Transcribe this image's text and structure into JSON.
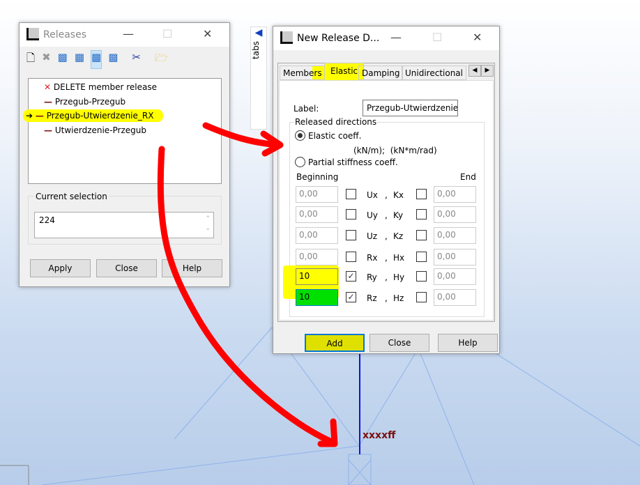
{
  "releases_window": {
    "title": "Releases",
    "list": [
      {
        "label": "DELETE member release",
        "icon": "delete-x-icon"
      },
      {
        "label": "Przegub-Przegub",
        "icon": "dash-icon"
      },
      {
        "label": "Przegub-Utwierdzenie_RX",
        "icon": "dash-icon",
        "current": true,
        "highlight": "#ffff00"
      },
      {
        "label": "Utwierdzenie-Przegub",
        "icon": "dash-icon"
      }
    ],
    "current_selection_label": "Current selection",
    "current_selection_value": "224",
    "apply": "Apply",
    "close": "Close",
    "help": "Help"
  },
  "side_tab": "tabs",
  "dialog": {
    "title": "New Release D...",
    "tabs": [
      "Members",
      "Elastic",
      "Damping",
      "Unidirectional"
    ],
    "active_tab": "Elastic",
    "label_caption": "Label:",
    "label_value": "Przegub-Utwierdzenie_",
    "group_title": "Released directions",
    "radio_elastic": "Elastic coeff.",
    "units": "(kN/m);  (kN*m/rad)",
    "radio_partial": "Partial stiffness coeff.",
    "beginning": "Beginning",
    "end": "End",
    "rows": [
      {
        "begin": "0,00",
        "begin_checked": false,
        "dir": "Ux",
        "sep": ",",
        "coef": "Kx",
        "end_checked": false,
        "end": "0,00"
      },
      {
        "begin": "0,00",
        "begin_checked": false,
        "dir": "Uy",
        "sep": ",",
        "coef": "Ky",
        "end_checked": false,
        "end": "0,00"
      },
      {
        "begin": "0,00",
        "begin_checked": false,
        "dir": "Uz",
        "sep": ",",
        "coef": "Kz",
        "end_checked": false,
        "end": "0,00"
      },
      {
        "begin": "0,00",
        "begin_checked": false,
        "dir": "Rx",
        "sep": ",",
        "coef": "Hx",
        "end_checked": false,
        "end": "0,00"
      },
      {
        "begin": "10",
        "begin_checked": true,
        "dir": "Ry",
        "sep": ",",
        "coef": "Hy",
        "end_checked": false,
        "end": "0,00",
        "bg": "#ffff00"
      },
      {
        "begin": "10",
        "begin_checked": true,
        "dir": "Rz",
        "sep": ",",
        "coef": "Hz",
        "end_checked": false,
        "end": "0,00",
        "bg": "#00e000"
      }
    ],
    "add": "Add",
    "close": "Close",
    "help": "Help"
  },
  "viewport": {
    "node_label": "xxxxff"
  },
  "colors": {
    "highlight": "#ffff00",
    "arrow": "#ff0000",
    "node_label": "#7a1010"
  }
}
